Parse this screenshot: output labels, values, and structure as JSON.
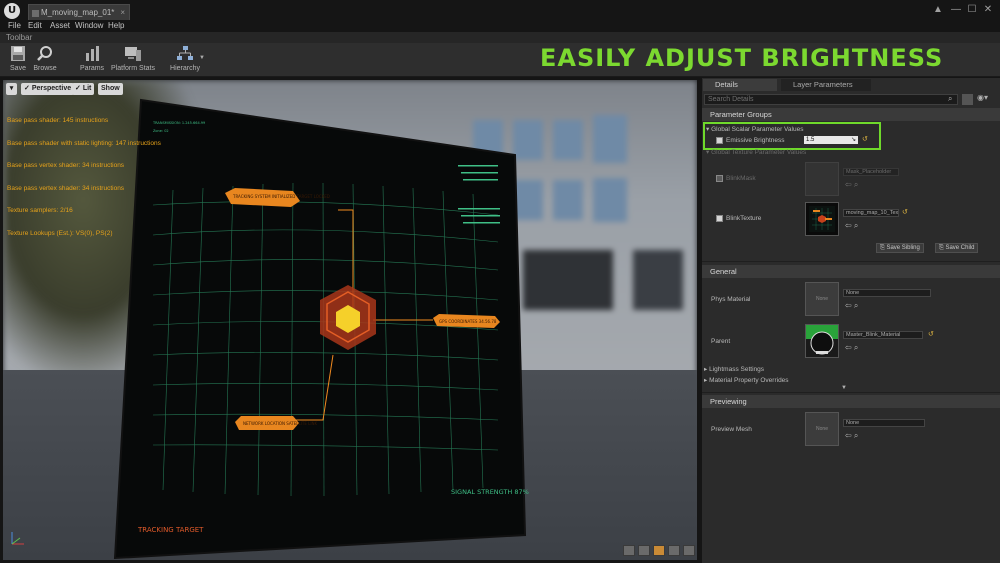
{
  "window": {
    "tab_title": "M_moving_map_01*",
    "minimize": "—",
    "maximize": "☐",
    "close": "✕"
  },
  "menu": [
    "File",
    "Edit",
    "Asset",
    "Window",
    "Help"
  ],
  "toolbar": {
    "label": "Toolbar",
    "buttons": [
      {
        "label": "Save",
        "icon": "save-icon"
      },
      {
        "label": "Browse",
        "icon": "search-icon"
      },
      {
        "label": "Params",
        "icon": "params-icon"
      },
      {
        "label": "Platform Stats",
        "icon": "platform-stats-icon"
      },
      {
        "label": "Hierarchy",
        "icon": "hierarchy-icon"
      }
    ]
  },
  "headline": "EASILY ADJUST BRIGHTNESS",
  "viewport": {
    "buttons": [
      "Perspective",
      "Lit",
      "Show"
    ],
    "stats": [
      "Base pass shader: 145 instructions",
      "Base pass shader with static lighting: 147 instructions",
      "Base pass vertex shader: 34 instructions",
      "Base pass vertex shader: 34 instructions",
      "Texture samplers: 2/16",
      "Texture Lookups (Est.): VS(0), PS(2)"
    ],
    "screen": {
      "header_text": "TRANSMISSION: 1.245.664.99",
      "header_sub": "Zone: 02",
      "callout_1": "TRACKING SYSTEM INITIALIZED TARGET LOCKED",
      "callout_2": "GPS COORDINATES 34.56.78",
      "callout_3": "NETWORK LOCATION SATELLITE LINK",
      "signal": "SIGNAL STRENGTH  87%",
      "tracking": "TRACKING TARGET"
    }
  },
  "details": {
    "tabs": [
      "Details",
      "Layer Parameters"
    ],
    "search_placeholder": "Search Details",
    "parameter_groups": "Parameter Groups",
    "global_scalar": "Global Scalar Parameter Values",
    "emissive_label": "Emissive Brightness",
    "emissive_value": "1.5",
    "global_texture": "Global Texture Parameter Values",
    "blink_mask_label": "BlinkMask",
    "blink_mask_value": "Mask_Placeholder",
    "blink_texture_label": "BlinkTexture",
    "blink_texture_value": "moving_map_10_Tex",
    "save_sibling": "Save Sibling",
    "save_child": "Save Child",
    "general": "General",
    "phys_material_label": "Phys Material",
    "phys_material_value": "None",
    "thumb_none": "None",
    "parent_label": "Parent",
    "parent_value": "Master_Blink_Material",
    "lightmass": "Lightmass Settings",
    "material_overrides": "Material Property Overrides",
    "previewing": "Previewing",
    "preview_mesh_label": "Preview Mesh",
    "preview_mesh_value": "None"
  },
  "colors": {
    "accent_green": "#7cd930",
    "highlight_green": "#6fd92b",
    "hud_orange": "#f08a20",
    "hud_grid": "#3fbf86"
  }
}
